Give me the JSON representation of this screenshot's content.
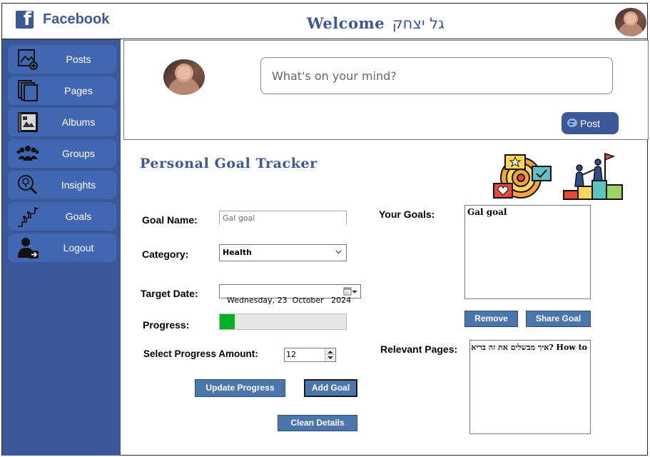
{
  "header": {
    "app_name": "Facebook",
    "welcome_label": "Welcome",
    "user_name": "גל יצחק"
  },
  "sidebar": {
    "items": [
      {
        "label": "Posts",
        "icon": "posts-icon"
      },
      {
        "label": "Pages",
        "icon": "pages-icon"
      },
      {
        "label": "Albums",
        "icon": "albums-icon"
      },
      {
        "label": "Groups",
        "icon": "groups-icon"
      },
      {
        "label": "Insights",
        "icon": "insights-icon"
      },
      {
        "label": "Goals",
        "icon": "goals-icon"
      },
      {
        "label": "Logout",
        "icon": "logout-icon"
      }
    ]
  },
  "composer": {
    "placeholder": "What's on your mind?",
    "post_label": "Post"
  },
  "tracker": {
    "title": "Personal Goal Tracker",
    "goal_name_label": "Goal Name:",
    "goal_name_value": "Gal goal",
    "category_label": "Category:",
    "category_value": "Health",
    "target_date_label": "Target Date:",
    "target_date_value": "Wednesday, 23  October   2024",
    "progress_label": "Progress:",
    "progress_value": 0.12,
    "select_amount_label": "Select Progress Amount:",
    "select_amount_value": "12",
    "update_progress_label": "Update Progress",
    "add_goal_label": "Add Goal",
    "clean_details_label": "Clean Details",
    "your_goals_label": "Your Goals:",
    "goals": [
      "Gal goal"
    ],
    "remove_label": "Remove",
    "share_goal_label": "Share Goal",
    "relevant_pages_label": "Relevant Pages:",
    "pages": [
      "How to ?איך מבשלים את זה בריא"
    ]
  },
  "colors": {
    "brand": "#3b5998",
    "sidebar_button": "#4267b2",
    "action_button": "#4a76ac",
    "progress_fill": "#06b025"
  }
}
